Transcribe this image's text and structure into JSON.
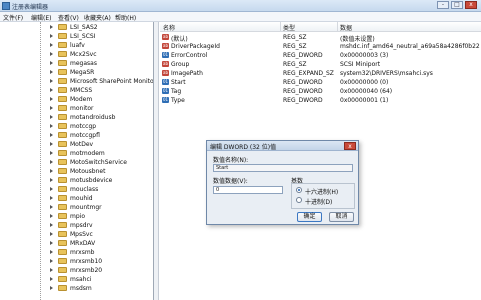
{
  "window": {
    "title": "注册表编辑器",
    "minimize": "-",
    "maximize": "□",
    "close": "x"
  },
  "menu": [
    "文件(F)",
    "编辑(E)",
    "查看(V)",
    "收藏夹(A)",
    "帮助(H)"
  ],
  "tree": {
    "items": [
      "LSI_SAS2",
      "LSI_SCSI",
      "luafv",
      "Mcx2Svc",
      "megasas",
      "MegaSR",
      "Microsoft SharePoint Monitor",
      "MMCSS",
      "Modem",
      "monitor",
      "motandroidusb",
      "motccgp",
      "motccgpfl",
      "MotDev",
      "motmodem",
      "MotoSwitchService",
      "Motousbnet",
      "motusbdevice",
      "mouclass",
      "mouhid",
      "mountmgr",
      "mpio",
      "mpsdrv",
      "MpsSvc",
      "MRxDAV",
      "mrxsmb",
      "mrxsmb10",
      "mrxsmb20",
      "msahci",
      "msdsm"
    ]
  },
  "list": {
    "columns": [
      "名称",
      "类型",
      "数据"
    ],
    "rows": [
      {
        "name": "(默认)",
        "type": "REG_SZ",
        "data": "(数值未设置)",
        "icon": "string-value-icon"
      },
      {
        "name": "DriverPackageId",
        "type": "REG_SZ",
        "data": "mshdc.inf_amd64_neutral_a69a58a4286f0b22",
        "icon": "string-value-icon"
      },
      {
        "name": "ErrorControl",
        "type": "REG_DWORD",
        "data": "0x00000003 (3)",
        "icon": "binary-value-icon"
      },
      {
        "name": "Group",
        "type": "REG_SZ",
        "data": "SCSI Miniport",
        "icon": "string-value-icon"
      },
      {
        "name": "ImagePath",
        "type": "REG_EXPAND_SZ",
        "data": "system32\\DRIVERS\\msahci.sys",
        "icon": "string-value-icon"
      },
      {
        "name": "Start",
        "type": "REG_DWORD",
        "data": "0x00000000 (0)",
        "icon": "binary-value-icon"
      },
      {
        "name": "Tag",
        "type": "REG_DWORD",
        "data": "0x00000040 (64)",
        "icon": "binary-value-icon"
      },
      {
        "name": "Type",
        "type": "REG_DWORD",
        "data": "0x00000001 (1)",
        "icon": "binary-value-icon"
      }
    ]
  },
  "dialog": {
    "title": "编辑 DWORD (32 位)值",
    "close": "x",
    "value_name_label": "数值名称(N):",
    "value_name": "Start",
    "value_data_label": "数值数据(V):",
    "value_data": "0",
    "base_label": "基数",
    "hex_label": "十六进制(H)",
    "dec_label": "十进制(D)",
    "ok": "确定",
    "cancel": "取消"
  },
  "colors": {
    "folder": "#e8c35b",
    "string_icon": "#c2463a",
    "binary_icon": "#2f6eb5",
    "dialog_bg": "#e9eef4"
  }
}
